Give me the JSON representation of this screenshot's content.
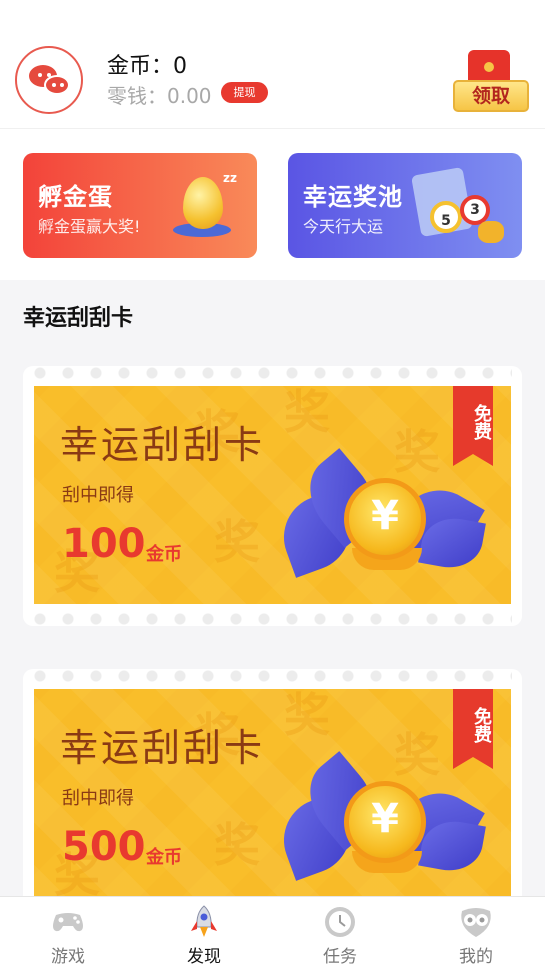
{
  "header": {
    "coins_label": "金币：0",
    "change_label": "零钱：0.00",
    "withdraw_label": "提现",
    "claim_label": "领取"
  },
  "promos": [
    {
      "title": "孵金蛋",
      "subtitle": "孵金蛋赢大奖!"
    },
    {
      "title": "幸运奖池",
      "subtitle": "今天行大运"
    }
  ],
  "section": {
    "title": "幸运刮刮卡"
  },
  "cards": [
    {
      "title": "幸运刮刮卡",
      "subtitle": "刮中即得",
      "amount": "100",
      "unit": "金币",
      "badge": "免费"
    },
    {
      "title": "幸运刮刮卡",
      "subtitle": "刮中即得",
      "amount": "500",
      "unit": "金币",
      "badge": "免费"
    }
  ],
  "tabs": [
    {
      "label": "游戏",
      "icon": "gamepad-icon",
      "active": false
    },
    {
      "label": "发现",
      "icon": "rocket-icon",
      "active": true
    },
    {
      "label": "任务",
      "icon": "clock-icon",
      "active": false
    },
    {
      "label": "我的",
      "icon": "owl-face-icon",
      "active": false
    }
  ],
  "colors": {
    "accent_red": "#e8392f",
    "card_yellow": "#f9be2a",
    "pool_blue": "#5a55e4"
  }
}
